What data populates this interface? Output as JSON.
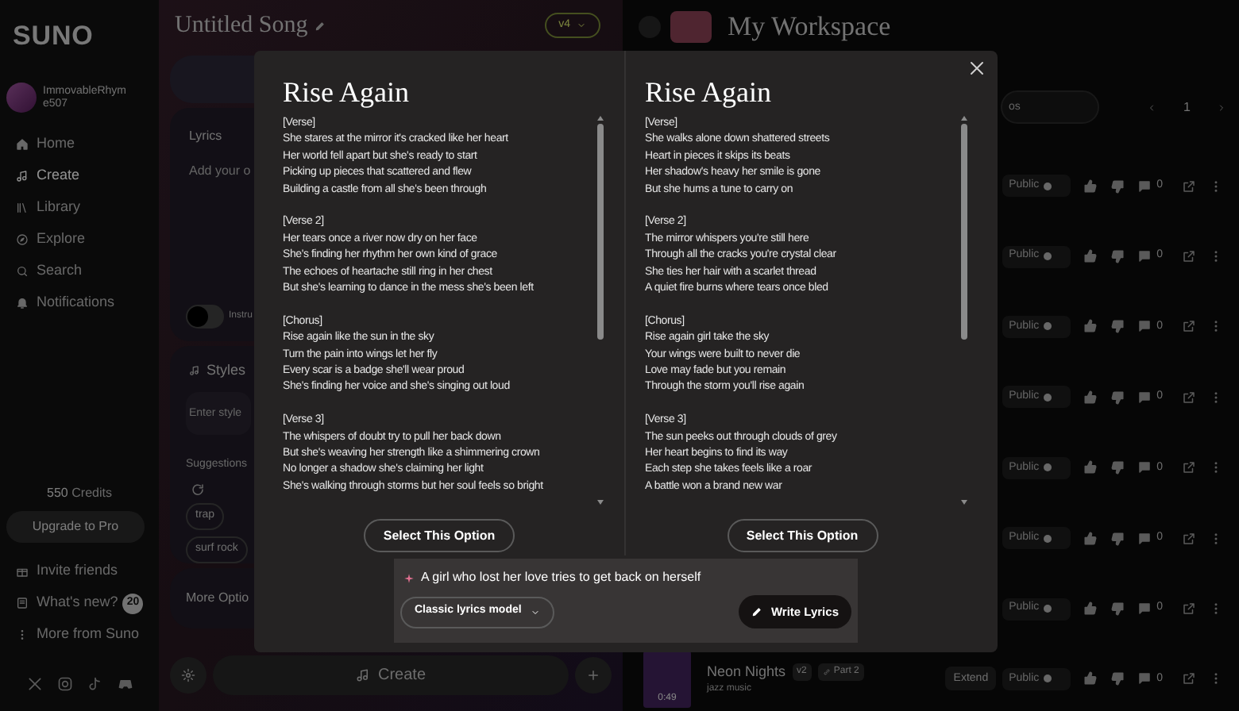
{
  "sidebar": {
    "logo": "SUNO",
    "user": {
      "name": "ImmovableRhym e507"
    },
    "nav": [
      {
        "label": "Home",
        "selected": false
      },
      {
        "label": "Create",
        "selected": true
      },
      {
        "label": "Library",
        "selected": false
      },
      {
        "label": "Explore",
        "selected": false
      },
      {
        "label": "Search",
        "selected": false
      },
      {
        "label": "Notifications",
        "selected": false
      }
    ],
    "credits": {
      "amount": "550",
      "label": "Credits"
    },
    "upgrade_button": "Upgrade to Pro",
    "links": [
      {
        "label": "Invite friends"
      },
      {
        "label": "What's new?",
        "badge": "20"
      },
      {
        "label": "More from Suno"
      }
    ]
  },
  "editor": {
    "title": "Untitled Song",
    "model": "v4",
    "lyrics_label": "Lyrics",
    "lyrics_placeholder": "Add your o",
    "instrumental": {
      "label": "Instru",
      "on": false
    },
    "styles_label": "Styles",
    "styles_placeholder": "Enter style",
    "suggestions_label": "Suggestions",
    "tags": [
      "trap",
      "surf rock"
    ],
    "more_options": "More Optio",
    "create_button": "Create"
  },
  "workspace": {
    "title": "My Workspace",
    "search_placeholder": "os",
    "page": "1",
    "rows": [
      {
        "public_label": "Public",
        "comments": "0"
      },
      {
        "public_label": "Public",
        "comments": "0"
      },
      {
        "public_label": "Public",
        "comments": "0"
      },
      {
        "public_label": "Public",
        "comments": "0"
      },
      {
        "public_label": "Public",
        "comments": "0"
      },
      {
        "public_label": "Public",
        "comments": "0"
      },
      {
        "public_label": "Public",
        "comments": "0"
      },
      {
        "title": "Neon Nights",
        "version": "v2",
        "tag": "Part 2",
        "style": "jazz music",
        "duration": "0:49",
        "action": "Extend",
        "public_label": "Public",
        "comments": "0"
      }
    ]
  },
  "modal": {
    "options": [
      {
        "title": "Rise Again",
        "button": "Select This Option",
        "sections": [
          {
            "heading": "[Verse]",
            "lines": [
              "She stares at the mirror it's cracked like her heart",
              "Her world fell apart but she's ready to start",
              "Picking up pieces that scattered and flew",
              "Building a castle from all she's been through"
            ]
          },
          {
            "heading": "[Verse 2]",
            "lines": [
              "Her tears once a river now dry on her face",
              "She's finding her rhythm her own kind of grace",
              "The echoes of heartache still ring in her chest",
              "But she's learning to dance in the mess she's been left"
            ]
          },
          {
            "heading": "[Chorus]",
            "lines": [
              "Rise again like the sun in the sky",
              "Turn the pain into wings let her fly",
              "Every scar is a badge she'll wear proud",
              "She's finding her voice and she's singing out loud"
            ]
          },
          {
            "heading": "[Verse 3]",
            "lines": [
              "The whispers of doubt try to pull her back down",
              "But she's weaving her strength like a shimmering crown",
              "No longer a shadow she's claiming her light",
              "She's walking through storms but her soul feels so bright"
            ]
          }
        ]
      },
      {
        "title": "Rise Again",
        "button": "Select This Option",
        "sections": [
          {
            "heading": "[Verse]",
            "lines": [
              "She walks alone down shattered streets",
              "Heart in pieces it skips its beats",
              "Her shadow's heavy her smile is gone",
              "But she hums a tune to carry on"
            ]
          },
          {
            "heading": "[Verse 2]",
            "lines": [
              "The mirror whispers you're still here",
              "Through all the cracks you're crystal clear",
              "She ties her hair with a scarlet thread",
              "A quiet fire burns where tears once bled"
            ]
          },
          {
            "heading": "[Chorus]",
            "lines": [
              "Rise again girl take the sky",
              "Your wings were built to never die",
              "Love may fade but you remain",
              "Through the storm you'll rise again"
            ]
          },
          {
            "heading": "[Verse 3]",
            "lines": [
              "The sun peeks out through clouds of grey",
              "Her heart begins to find its way",
              "Each step she takes feels like a roar",
              "A battle won a brand new war"
            ]
          }
        ]
      }
    ],
    "prompt": "A girl who lost her love tries to get back on herself",
    "model_dropdown": "Classic lyrics model",
    "write_button": "Write Lyrics"
  }
}
